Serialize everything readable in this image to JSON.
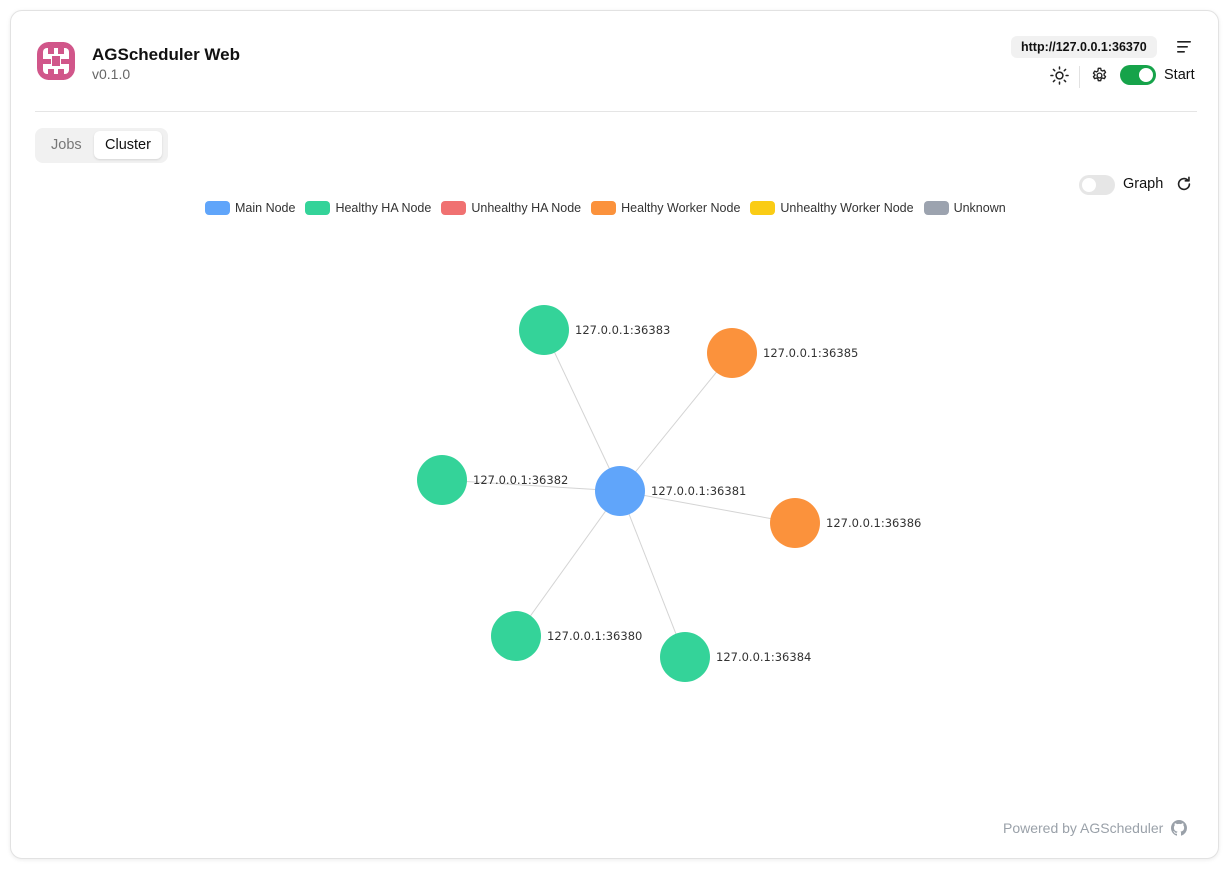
{
  "header": {
    "title": "AGScheduler Web",
    "version": "v0.1.0",
    "url": "http://127.0.0.1:36370",
    "start_label": "Start",
    "start_enabled": true
  },
  "tabs": [
    {
      "label": "Jobs",
      "active": false
    },
    {
      "label": "Cluster",
      "active": true
    }
  ],
  "graph_toggle": {
    "label": "Graph",
    "enabled": false
  },
  "legend": [
    {
      "label": "Main Node",
      "color": "#60a5fa"
    },
    {
      "label": "Healthy HA Node",
      "color": "#34d399"
    },
    {
      "label": "Unhealthy HA Node",
      "color": "#f07171"
    },
    {
      "label": "Healthy Worker Node",
      "color": "#fb923c"
    },
    {
      "label": "Unhealthy Worker Node",
      "color": "#facc15"
    },
    {
      "label": "Unknown",
      "color": "#9ca3af"
    }
  ],
  "nodes": [
    {
      "id": "127.0.0.1:36381",
      "type": "Main Node"
    },
    {
      "id": "127.0.0.1:36383",
      "type": "Healthy HA Node"
    },
    {
      "id": "127.0.0.1:36385",
      "type": "Healthy Worker Node"
    },
    {
      "id": "127.0.0.1:36382",
      "type": "Healthy HA Node"
    },
    {
      "id": "127.0.0.1:36386",
      "type": "Healthy Worker Node"
    },
    {
      "id": "127.0.0.1:36380",
      "type": "Healthy HA Node"
    },
    {
      "id": "127.0.0.1:36384",
      "type": "Healthy HA Node"
    }
  ],
  "edges": [
    {
      "source": "127.0.0.1:36381",
      "target": "127.0.0.1:36383"
    },
    {
      "source": "127.0.0.1:36381",
      "target": "127.0.0.1:36385"
    },
    {
      "source": "127.0.0.1:36381",
      "target": "127.0.0.1:36382"
    },
    {
      "source": "127.0.0.1:36381",
      "target": "127.0.0.1:36386"
    },
    {
      "source": "127.0.0.1:36381",
      "target": "127.0.0.1:36380"
    },
    {
      "source": "127.0.0.1:36381",
      "target": "127.0.0.1:36384"
    }
  ],
  "footer": {
    "text": "Powered by AGScheduler"
  }
}
